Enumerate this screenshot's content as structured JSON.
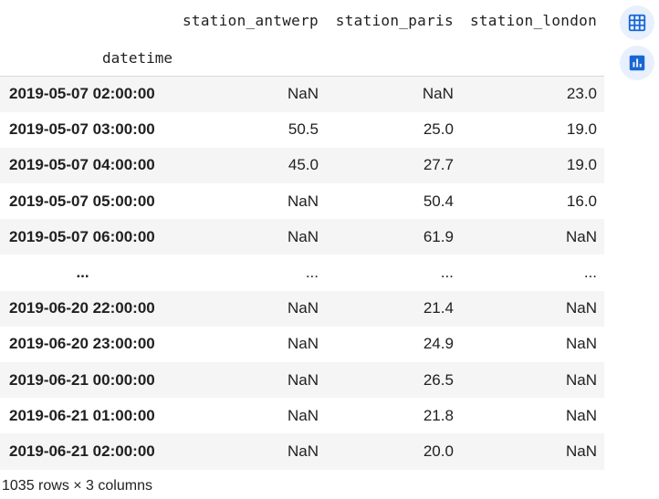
{
  "table": {
    "columns": [
      "station_antwerp",
      "station_paris",
      "station_london"
    ],
    "index_name": "datetime",
    "rows": [
      {
        "index": "2019-05-07 02:00:00",
        "values": [
          "NaN",
          "NaN",
          "23.0"
        ]
      },
      {
        "index": "2019-05-07 03:00:00",
        "values": [
          "50.5",
          "25.0",
          "19.0"
        ]
      },
      {
        "index": "2019-05-07 04:00:00",
        "values": [
          "45.0",
          "27.7",
          "19.0"
        ]
      },
      {
        "index": "2019-05-07 05:00:00",
        "values": [
          "NaN",
          "50.4",
          "16.0"
        ]
      },
      {
        "index": "2019-05-07 06:00:00",
        "values": [
          "NaN",
          "61.9",
          "NaN"
        ]
      },
      {
        "index": "...",
        "values": [
          "...",
          "...",
          "..."
        ]
      },
      {
        "index": "2019-06-20 22:00:00",
        "values": [
          "NaN",
          "21.4",
          "NaN"
        ]
      },
      {
        "index": "2019-06-20 23:00:00",
        "values": [
          "NaN",
          "24.9",
          "NaN"
        ]
      },
      {
        "index": "2019-06-21 00:00:00",
        "values": [
          "NaN",
          "26.5",
          "NaN"
        ]
      },
      {
        "index": "2019-06-21 01:00:00",
        "values": [
          "NaN",
          "21.8",
          "NaN"
        ]
      },
      {
        "index": "2019-06-21 02:00:00",
        "values": [
          "NaN",
          "20.0",
          "NaN"
        ]
      }
    ],
    "shape_text": "1035 rows × 3 columns"
  },
  "side_buttons": {
    "table_icon": "interactive-table-icon",
    "chart_icon": "bar-chart-icon",
    "accent_color": "#1967d2",
    "bg_color": "#e8f0fe"
  }
}
